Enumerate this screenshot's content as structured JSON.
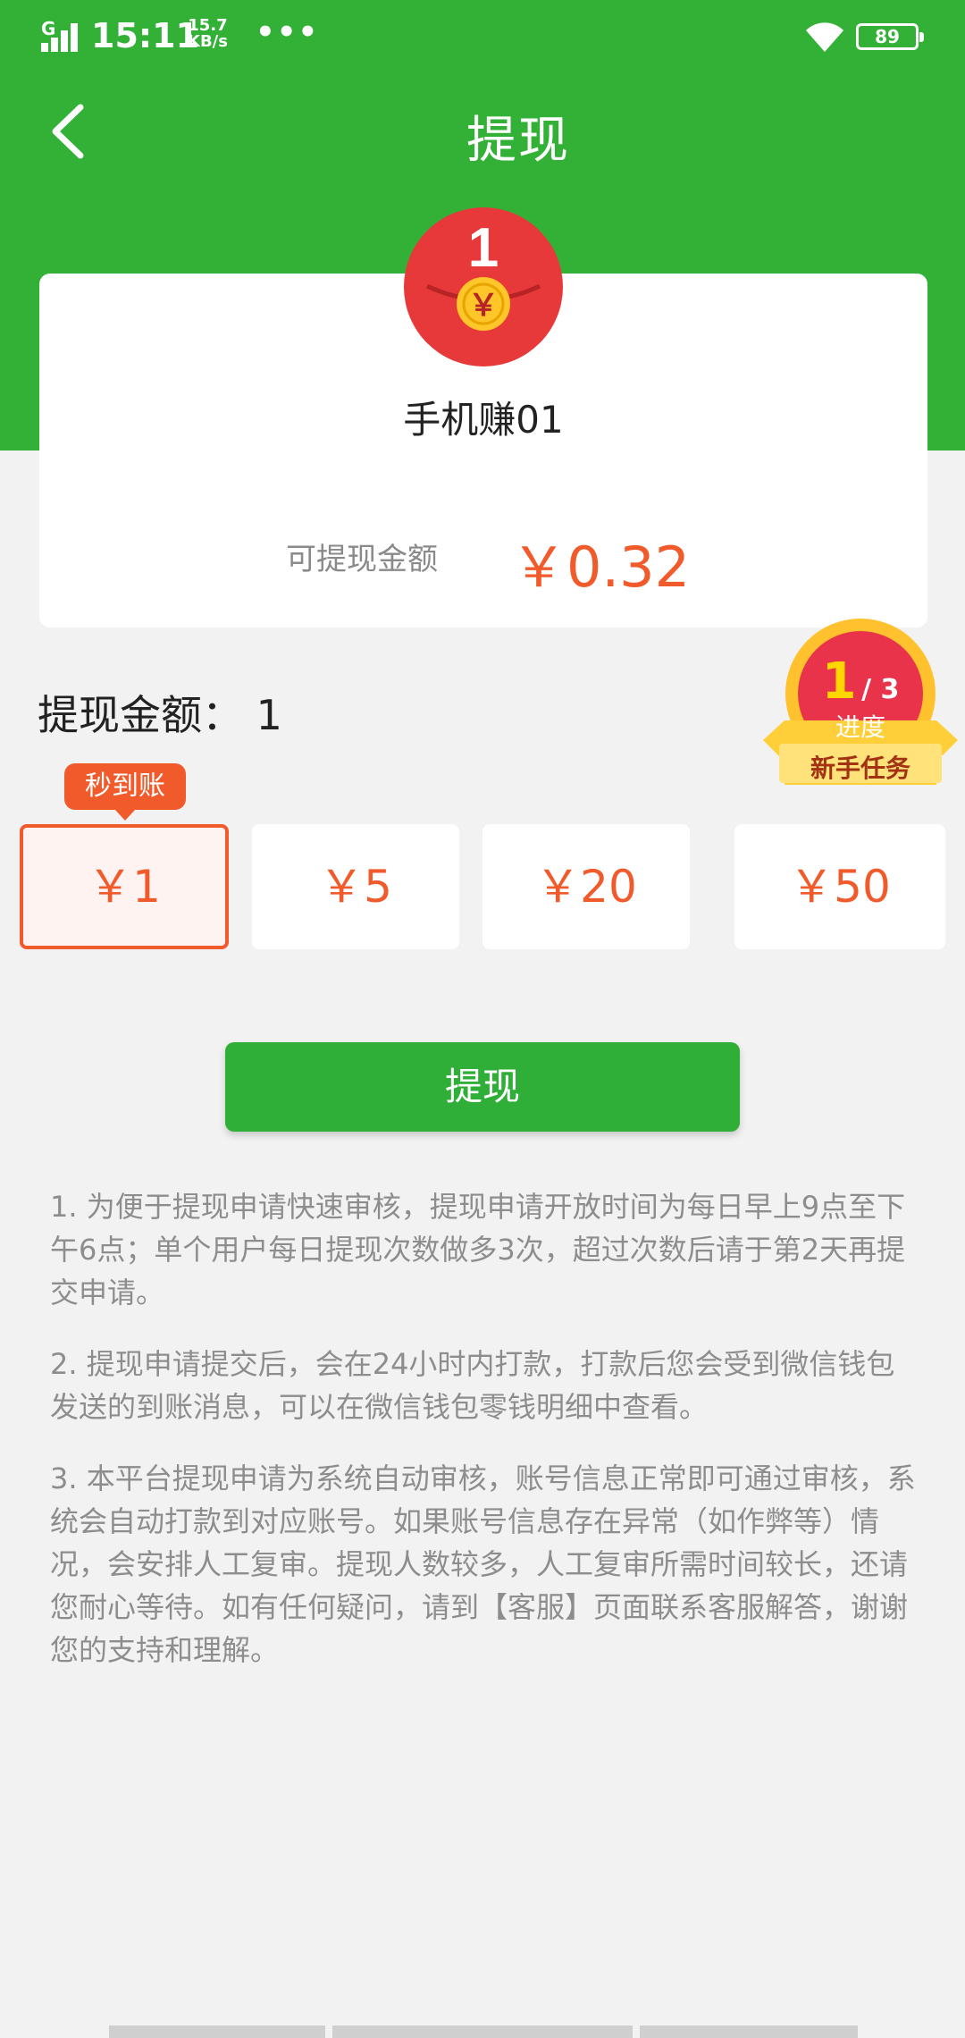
{
  "status_bar": {
    "network": "G",
    "time": "15:11",
    "speed_value": "15.7",
    "speed_unit": "KB/s",
    "dots": "•••",
    "battery": "89"
  },
  "header": {
    "title": "提现",
    "back_icon": "chevron-left-icon"
  },
  "card": {
    "hongbao_number": "1",
    "hongbao_symbol": "￥",
    "app_name": "手机赚01",
    "balance_label": "可提现金额",
    "balance_value": "￥0.32"
  },
  "withdraw": {
    "amount_title": "提现金额：  1",
    "instant_tag": "秒到账",
    "options": [
      "￥1",
      "￥5",
      "￥20",
      "￥50"
    ],
    "selected_index": 0,
    "submit_label": "提现"
  },
  "task_badge": {
    "current": "1",
    "total": "/ 3",
    "sub_label": "进度",
    "ribbon_label": "新手任务"
  },
  "notes": [
    "1. 为便于提现申请快速审核，提现申请开放时间为每日早上9点至下午6点；单个用户每日提现次数做多3次，超过次数后请于第2天再提交申请。",
    "2. 提现申请提交后，会在24小时内打款，打款后您会受到微信钱包发送的到账消息，可以在微信钱包零钱明细中查看。",
    "3. 本平台提现申请为系统自动审核，账号信息正常即可通过审核，系统会自动打款到对应账号。如果账号信息存在异常（如作弊等）情况，会安排人工复审。提现人数较多，人工复审所需时间较长，还请您耐心等待。如有任何疑问，请到【客服】页面联系客服解答，谢谢您的支持和理解。"
  ],
  "colors": {
    "header_green": "#33b137",
    "accent_orange": "#f15b2c",
    "button_green": "#2fae38"
  }
}
